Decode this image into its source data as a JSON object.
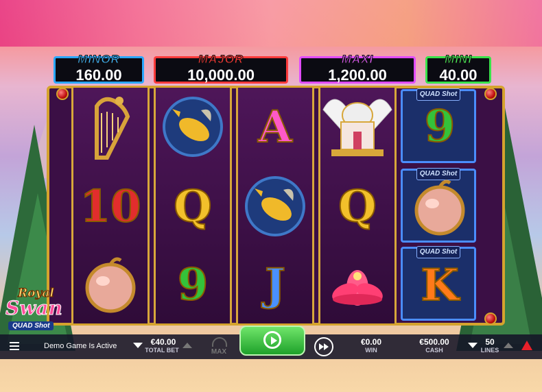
{
  "jackpots": {
    "minor": {
      "label": "MINOR",
      "value": "160.00"
    },
    "major": {
      "label": "MAJOR",
      "value": "10,000.00"
    },
    "maxi": {
      "label": "MAXI",
      "value": "1,200.00"
    },
    "mini": {
      "label": "MINI",
      "value": "40.00"
    }
  },
  "reels": {
    "r1": {
      "row1_icon": "harp-icon",
      "row2": "10",
      "row3_icon": "apple-icon"
    },
    "r2": {
      "row1_icon": "koi-fish-icon",
      "row2": "Q",
      "row3": "9"
    },
    "r3": {
      "row1": "A",
      "row2_icon": "koi-fish-icon",
      "row3": "J"
    },
    "r4": {
      "row1_icon": "palace-icon",
      "row2": "Q",
      "row3_icon": "lotus-icon"
    },
    "r5": {
      "label": "QUAD Shot",
      "row1": "9",
      "row2_icon": "apple-icon",
      "row3": "K"
    }
  },
  "logo": {
    "line1": "Royal",
    "line2": "Swan",
    "line3": "QUAD Shot"
  },
  "bottom_bar": {
    "menu_icon": "hamburger-icon",
    "status": "Demo Game Is Active",
    "total_bet_value": "€40.00",
    "total_bet_label": "TOTAL BET",
    "max_label": "MAX",
    "win_value": "€0.00",
    "win_label": "WIN",
    "cash_value": "€500.00",
    "cash_label": "CASH",
    "lines_value": "50",
    "lines_label": "LINES"
  },
  "colors": {
    "minor": "#2aa8ff",
    "major": "#ff3b3b",
    "maxi": "#e14cff",
    "mini": "#39e24a",
    "spin": "#1ea12a"
  }
}
